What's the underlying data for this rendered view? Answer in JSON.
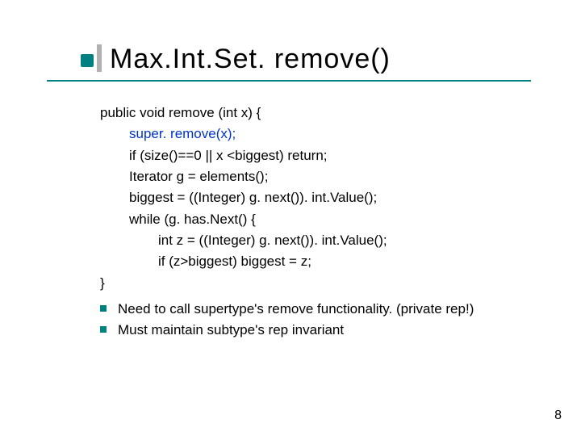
{
  "title": "Max.Int.Set. remove()",
  "code": {
    "sig": "public void remove (int x) {",
    "l1": "super. remove(x);",
    "l2": "if (size()==0 || x <biggest) return;",
    "l3": "Iterator g = elements();",
    "l4": "biggest = ((Integer) g. next()). int.Value();",
    "l5": "while (g. has.Next() {",
    "l6": "int z = ((Integer) g. next()). int.Value();",
    "l7": "if (z>biggest) biggest = z;",
    "end": "}"
  },
  "bullets": {
    "b1": "Need to call supertype's remove functionality. (private rep!)",
    "b2": "Must maintain subtype's rep invariant"
  },
  "page": "8"
}
